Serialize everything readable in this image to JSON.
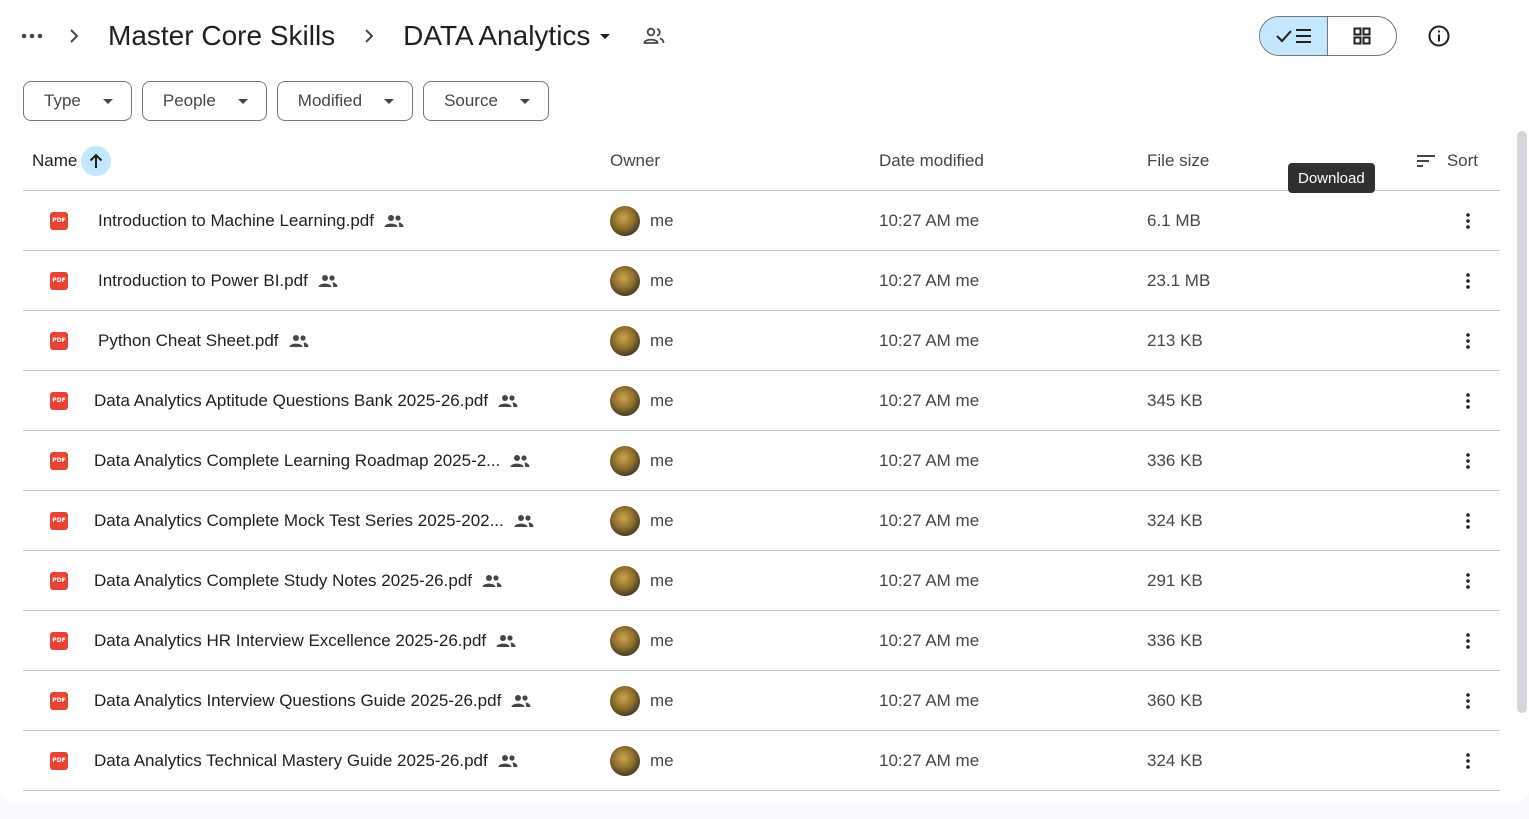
{
  "breadcrumb": {
    "parent": "Master Core Skills",
    "current": "DATA Analytics"
  },
  "filters": [
    "Type",
    "People",
    "Modified",
    "Source"
  ],
  "columns": {
    "name": "Name",
    "owner": "Owner",
    "date": "Date modified",
    "size": "File size",
    "sort": "Sort"
  },
  "tooltip": "Download",
  "files": [
    {
      "name": "Introduction to Machine Learning.pdf",
      "owner": "me",
      "date": "10:27 AM me",
      "size": "6.1 MB"
    },
    {
      "name": "Introduction to Power BI.pdf",
      "owner": "me",
      "date": "10:27 AM me",
      "size": "23.1 MB"
    },
    {
      "name": "Python Cheat Sheet.pdf",
      "owner": "me",
      "date": "10:27 AM me",
      "size": "213 KB"
    },
    {
      "name": "Data Analytics Aptitude Questions Bank 2025-26.pdf",
      "owner": "me",
      "date": "10:27 AM me",
      "size": "345 KB"
    },
    {
      "name": "Data Analytics Complete Learning Roadmap 2025-2...",
      "owner": "me",
      "date": "10:27 AM me",
      "size": "336 KB"
    },
    {
      "name": "Data Analytics Complete Mock Test Series 2025-202...",
      "owner": "me",
      "date": "10:27 AM me",
      "size": "324 KB"
    },
    {
      "name": "Data Analytics Complete Study Notes 2025-26.pdf",
      "owner": "me",
      "date": "10:27 AM me",
      "size": "291 KB"
    },
    {
      "name": "Data Analytics HR Interview Excellence 2025-26.pdf",
      "owner": "me",
      "date": "10:27 AM me",
      "size": "336 KB"
    },
    {
      "name": "Data Analytics Interview Questions Guide 2025-26.pdf",
      "owner": "me",
      "date": "10:27 AM me",
      "size": "360 KB"
    },
    {
      "name": "Data Analytics Technical Mastery Guide 2025-26.pdf",
      "owner": "me",
      "date": "10:27 AM me",
      "size": "324 KB"
    }
  ]
}
